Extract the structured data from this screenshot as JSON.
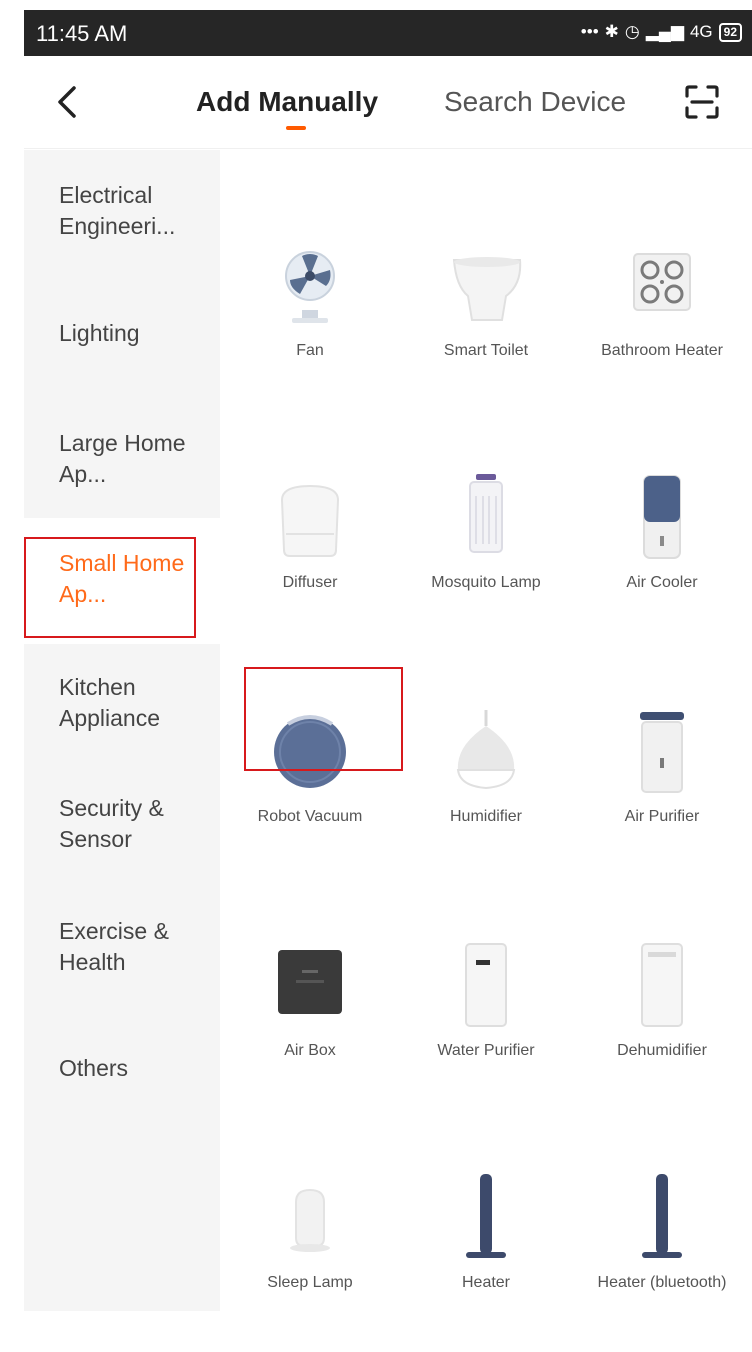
{
  "status_bar": {
    "time": "11:45 AM",
    "icons": [
      "more-dots-icon",
      "bluetooth-icon",
      "alarm-icon",
      "signal-icon"
    ],
    "network": "4G",
    "battery": "92"
  },
  "header": {
    "tabs": [
      {
        "label": "Add Manually",
        "active": true
      },
      {
        "label": "Search Device",
        "active": false
      }
    ],
    "accent_color": "#ff5a00"
  },
  "sidebar": {
    "items": [
      {
        "label": "Electrical Engineeri..."
      },
      {
        "label": "Lighting"
      },
      {
        "label": "Large Home Ap..."
      },
      {
        "label": "Small Home Ap...",
        "selected": true
      },
      {
        "label": "Kitchen Appliance"
      },
      {
        "label": "Security & Sensor"
      },
      {
        "label": "Exercise & Health"
      },
      {
        "label": "Others"
      }
    ]
  },
  "devices": [
    {
      "name": "Fan",
      "icon": "fan-icon"
    },
    {
      "name": "Smart Toilet",
      "icon": "toilet-icon"
    },
    {
      "name": "Bathroom Heater",
      "icon": "bathroom-heater-icon"
    },
    {
      "name": "Diffuser",
      "icon": "diffuser-icon"
    },
    {
      "name": "Mosquito Lamp",
      "icon": "mosquito-lamp-icon"
    },
    {
      "name": "Air Cooler",
      "icon": "air-cooler-icon"
    },
    {
      "name": "Robot Vacuum",
      "icon": "robot-vacuum-icon",
      "highlighted": true
    },
    {
      "name": "Humidifier",
      "icon": "humidifier-icon"
    },
    {
      "name": "Air Purifier",
      "icon": "air-purifier-icon"
    },
    {
      "name": "Air Box",
      "icon": "air-box-icon"
    },
    {
      "name": "Water Purifier",
      "icon": "water-purifier-icon"
    },
    {
      "name": "Dehumidifier",
      "icon": "dehumidifier-icon"
    },
    {
      "name": "Sleep Lamp",
      "icon": "sleep-lamp-icon"
    },
    {
      "name": "Heater",
      "icon": "heater-icon"
    },
    {
      "name": "Heater (bluetooth)",
      "icon": "heater-bluetooth-icon"
    }
  ]
}
